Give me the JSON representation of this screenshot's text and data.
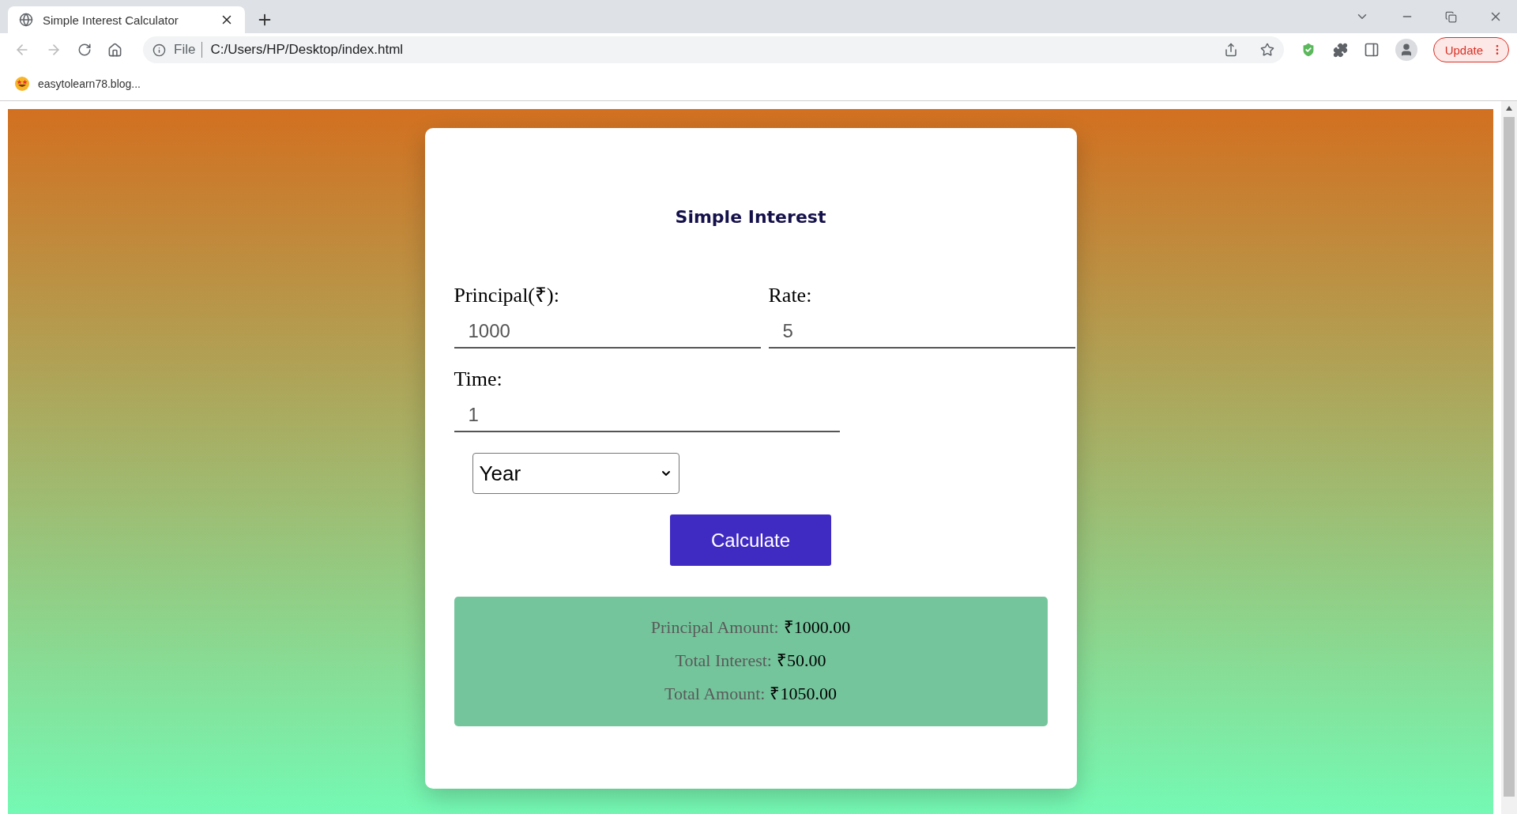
{
  "browser": {
    "tab": {
      "title": "Simple Interest Calculator",
      "selected": true
    },
    "address": {
      "scheme": "File",
      "url": "C:/Users/HP/Desktop/index.html"
    },
    "update_button": "Update",
    "bookmarks": [
      "easytolearn78.blog..."
    ]
  },
  "card": {
    "title": "Simple Interest",
    "fields": [
      {
        "label": "Principal(₹):",
        "value": "1000"
      },
      {
        "label": "Rate:",
        "value": "5"
      },
      {
        "label": "Time:",
        "value": "1"
      }
    ],
    "unit_select": "Year",
    "button": "Calculate",
    "results": [
      {
        "label": "Principal Amount:",
        "value": "₹1000.00"
      },
      {
        "label": "Total Interest:",
        "value": "₹50.00"
      },
      {
        "label": "Total Amount:",
        "value": "₹1050.00"
      }
    ]
  }
}
